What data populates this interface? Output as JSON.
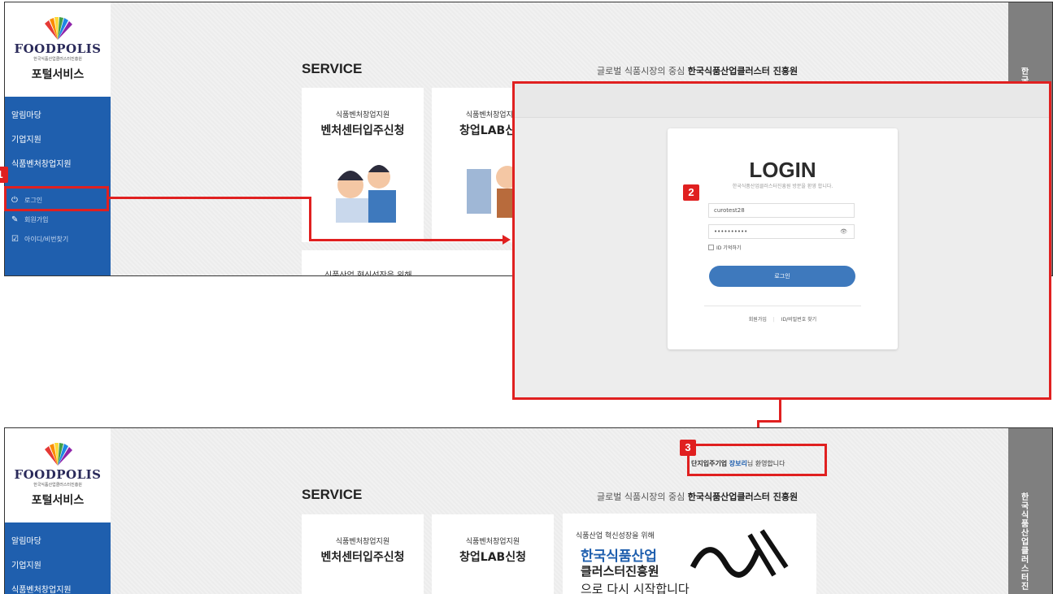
{
  "brand": {
    "logo_text": "FOODPOLIS",
    "logo_sub": "한국식품산업클러스터진흥원",
    "portal_title": "포털서비스"
  },
  "sidebar": {
    "menu": [
      "알림마당",
      "기업지원",
      "식품벤처창업지원"
    ],
    "sub": {
      "login": "로그인",
      "signup": "회원가입",
      "find": "아이디/비번찾기"
    }
  },
  "right_strip_text": "한국식품산업클러스터진",
  "main": {
    "service_title": "SERVICE",
    "tagline_prefix": "글로벌 식품시장의 중심",
    "tagline_bold": "한국식품산업클러스터 진흥원",
    "cards": [
      {
        "sub": "식품벤처창업지원",
        "title": "벤처센터입주신청"
      },
      {
        "sub": "식품벤처창업지원",
        "title": "창업LAB신청"
      }
    ],
    "partial_card_text": "식품산업 혁신성장을 위해",
    "banner": {
      "line1": "식품산업 혁신성장을 위해",
      "line2": "한국식품산업",
      "line3": "클러스터진흥원",
      "line4": "으로 다시 시작합니다"
    }
  },
  "login": {
    "title": "LOGIN",
    "subtitle": "한국식품산업클러스터진흥원 방문을 환영 합니다.",
    "id_value": "curotest28",
    "password_value": "••••••••••",
    "remember_label": "ID 기억하기",
    "button_label": "로그인",
    "link_signup": "회원가입",
    "link_find": "ID/비밀번호 찾기"
  },
  "welcome": {
    "prefix": "단지입주기업",
    "name": "장보리",
    "suffix": "님 환영합니다"
  },
  "badges": {
    "b1": "1",
    "b2": "2",
    "b3": "3"
  },
  "colors": {
    "accent_red": "#e02020",
    "sidebar_blue": "#1f5fae",
    "button_blue": "#3e79bd"
  }
}
